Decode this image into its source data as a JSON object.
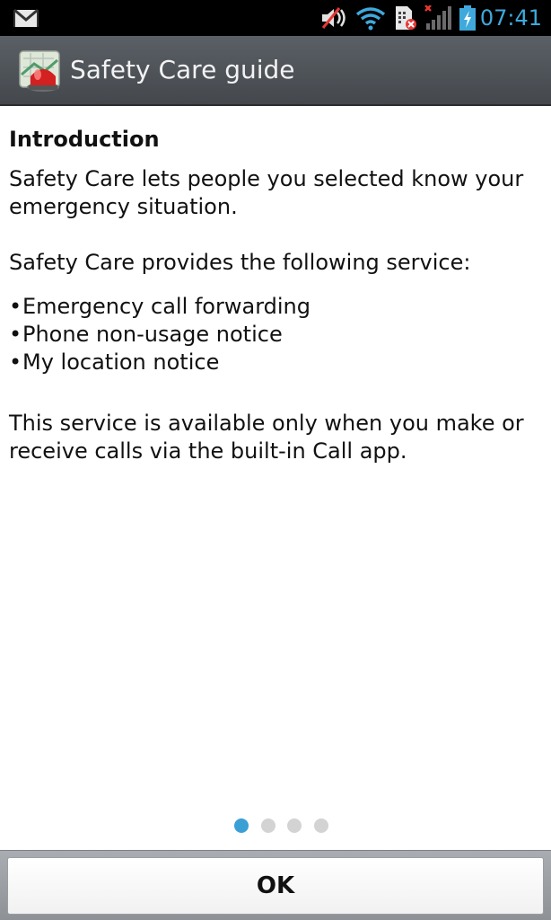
{
  "status_bar": {
    "time": "07:41",
    "icons": [
      "gmail-icon",
      "mute-icon",
      "wifi-icon",
      "sim-error-icon",
      "signal-icon",
      "battery-charging-icon"
    ],
    "time_color": "#3fa9dc"
  },
  "action_bar": {
    "title": "Safety Care guide",
    "icon": "safety-care-app-icon"
  },
  "content": {
    "heading": "Introduction",
    "para1": "Safety Care lets people you selected know your emergency situation.",
    "para2": "Safety Care provides the following service:",
    "bullets": [
      "Emergency call forwarding",
      "Phone non-usage notice",
      "My location notice"
    ],
    "bullet_symbol": "•",
    "para3": "This service is available only when you make or receive calls via the built-in Call app."
  },
  "pager": {
    "pages": 4,
    "current": 1,
    "active_color": "#3a9fd4"
  },
  "footer": {
    "ok_label": "OK"
  }
}
